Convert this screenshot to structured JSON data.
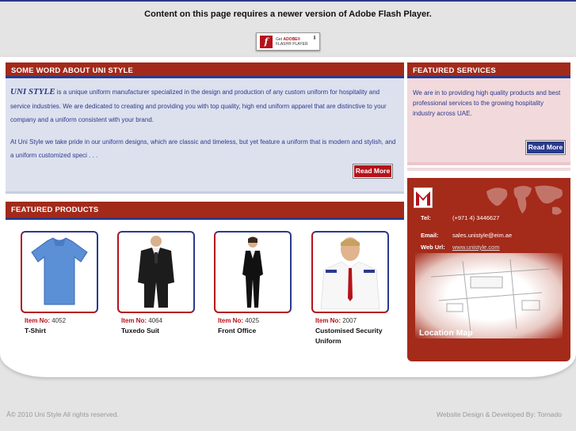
{
  "flash": {
    "message": "Content on this page requires a newer version of Adobe Flash Player.",
    "badge_line1": "Get",
    "badge_line2": "ADOBE®",
    "badge_line3": "FLASH® PLAYER"
  },
  "about": {
    "title": "SOME WORD ABOUT UNI STYLE",
    "brand": "UNI STYLE",
    "para1_rest": " is a unique uniform manufacturer specialized in the design and production of any custom uniform for hospitality and service industries. We are dedicated to creating and providing you with top quality, high end uniform apparel that are distinctive to your company and a uniform consistent with your brand.",
    "para2": "At Uni Style we take pride in our uniform designs, which are classic and timeless, but yet feature a uniform that is modern and stylish, and a uniform customized speci . . .",
    "read_more": "Read More"
  },
  "services": {
    "title": "FEATURED SERVICES",
    "body": "We are in to providing high quality products and best professional services to the growing hospitality industry across UAE.",
    "read_more": "Read More"
  },
  "products": {
    "title": "FEATURED PRODUCTS",
    "item_label": "Item No:",
    "items": [
      {
        "number": "4052",
        "name": "T-Shirt"
      },
      {
        "number": "4064",
        "name": "Tuxedo Suit"
      },
      {
        "number": "4025",
        "name": "Front Office"
      },
      {
        "number": "2007",
        "name": "Customised Security Uniform"
      }
    ]
  },
  "contact": {
    "tel_label": "Tel:",
    "tel_value": "(+971 4) 3446627",
    "email_label": "Email:",
    "email_value": "sales.unistyle@eim.ae",
    "web_label": "Web Url:",
    "web_value": "www.unistyle.com",
    "map_title": "Location Map"
  },
  "footer": {
    "copyright": "Â© 2010 Uni Style All rights reserved.",
    "credit": "Website Design & Developed By: Tornado"
  },
  "colors": {
    "accent_red": "#a22a1a",
    "accent_blue": "#2a3a8c"
  }
}
